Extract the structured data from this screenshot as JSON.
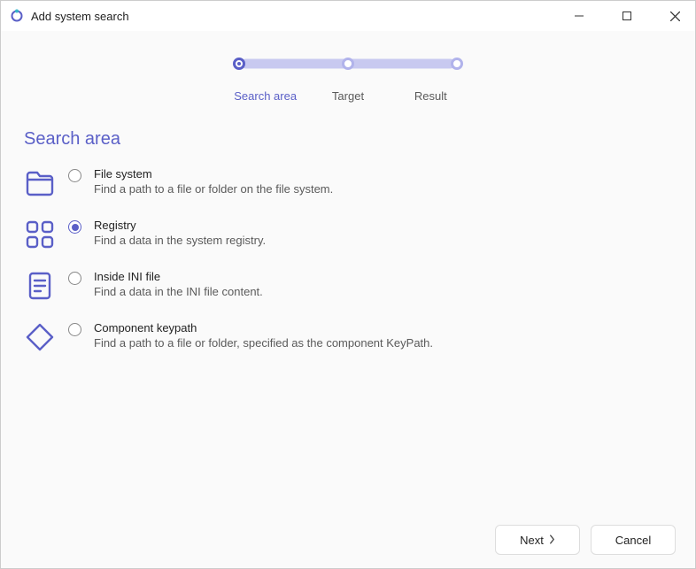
{
  "window": {
    "title": "Add system search"
  },
  "steps": {
    "s1": "Search area",
    "s2": "Target",
    "s3": "Result",
    "active_index": 0
  },
  "section_title": "Search area",
  "options": {
    "filesystem": {
      "title": "File system",
      "desc": "Find a path to a file or folder on the file system.",
      "checked": false
    },
    "registry": {
      "title": "Registry",
      "desc": "Find a data in the system registry.",
      "checked": true
    },
    "ini": {
      "title": "Inside INI file",
      "desc": "Find a data in the INI file content.",
      "checked": false
    },
    "component": {
      "title": "Component keypath",
      "desc": "Find a path to a file or folder, specified as the component KeyPath.",
      "checked": false
    }
  },
  "buttons": {
    "next": "Next",
    "cancel": "Cancel"
  },
  "colors": {
    "accent": "#5a5fc7"
  }
}
